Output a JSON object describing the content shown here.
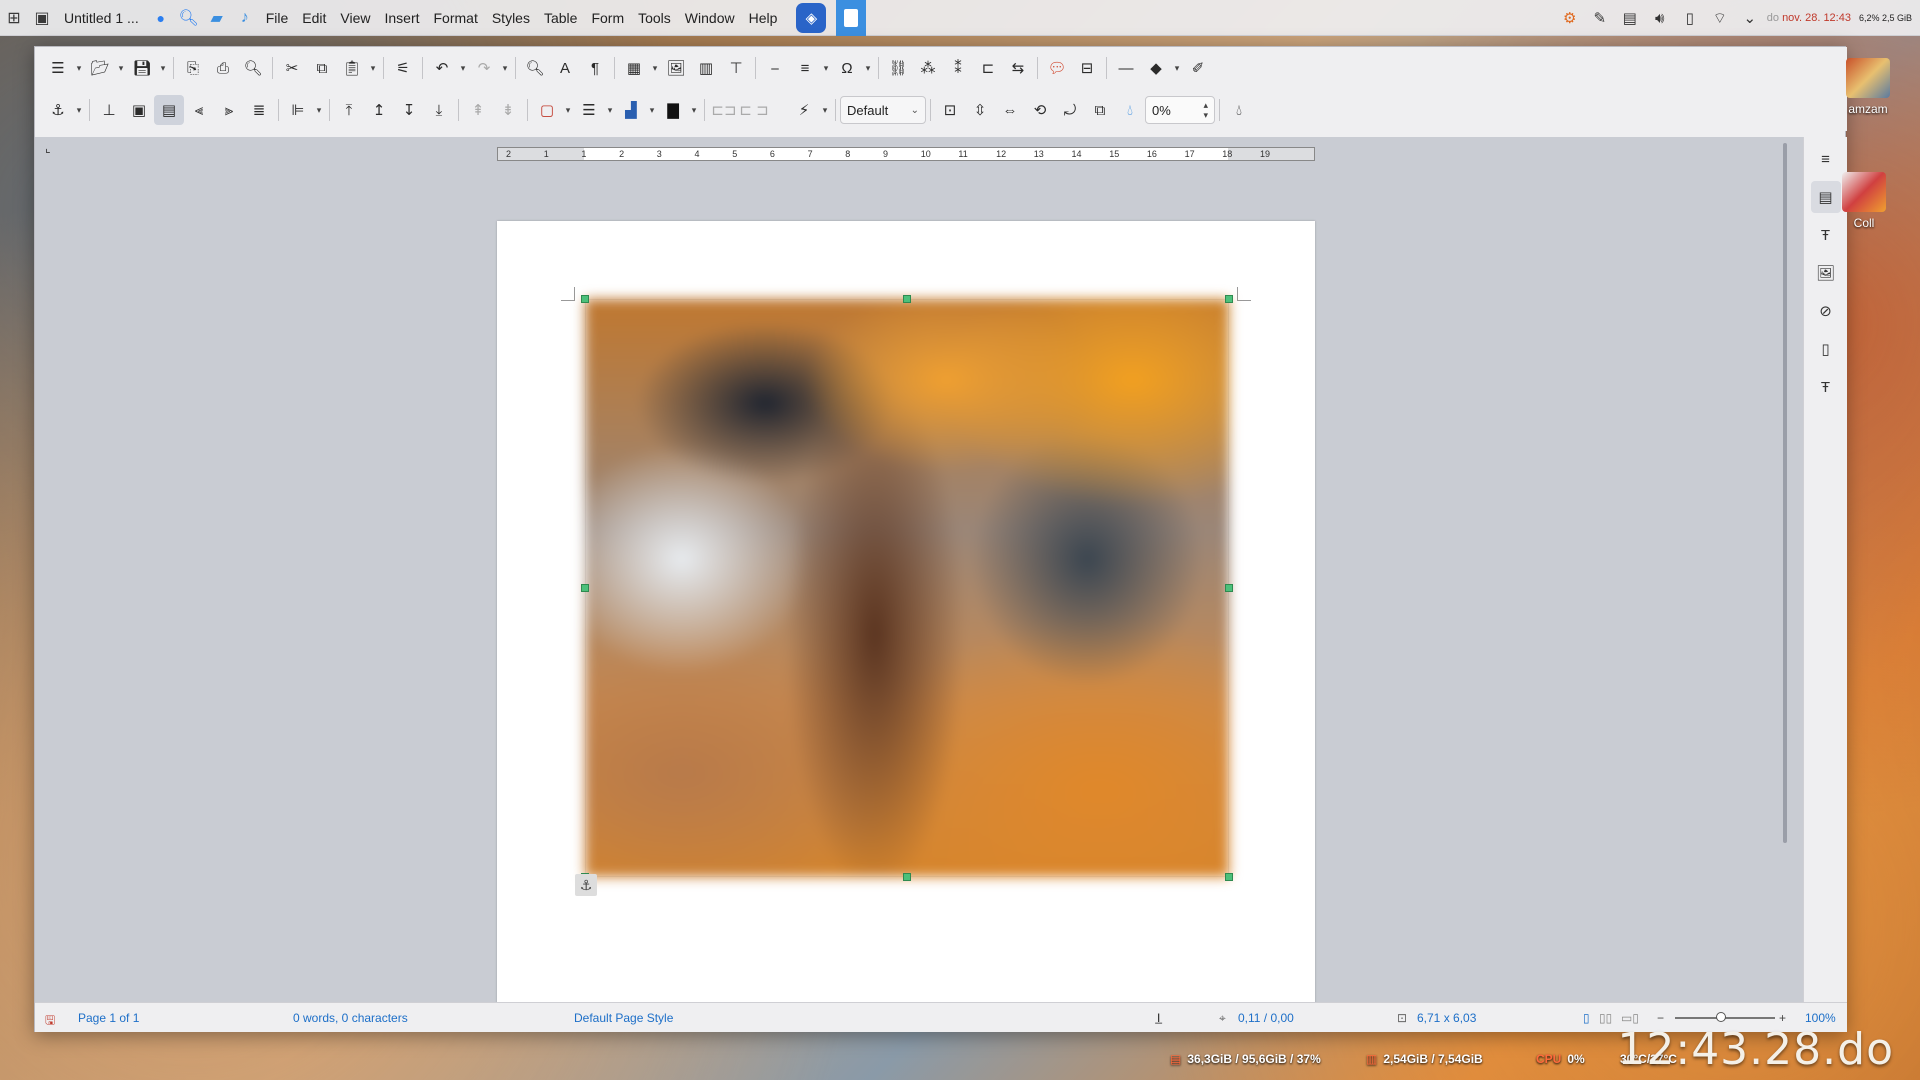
{
  "taskbar": {
    "window_title": "Untitled 1 ...",
    "menu": [
      "File",
      "Edit",
      "View",
      "Insert",
      "Format",
      "Styles",
      "Table",
      "Form",
      "Tools",
      "Window",
      "Help"
    ],
    "clock_text": "nov. 28. 12:43",
    "clock_prefix": "do",
    "mini_stats_top": "6,2%  2,5 GiB"
  },
  "toolbar2": {
    "frame_style": "Default",
    "transparency": "0%"
  },
  "ruler": {
    "numbers": [
      "2",
      "1",
      "1",
      "2",
      "3",
      "4",
      "5",
      "6",
      "7",
      "8",
      "9",
      "10",
      "11",
      "12",
      "13",
      "14",
      "15",
      "16",
      "17",
      "18",
      "19"
    ]
  },
  "statusbar": {
    "page": "Page 1 of 1",
    "words": "0 words, 0 characters",
    "page_style": "Default Page Style",
    "position": "0,11 / 0,00",
    "size": "6,71 x 6,03",
    "zoom": "100%",
    "zoom_minus": "−",
    "zoom_plus": "+"
  },
  "desktop": {
    "icon1_label": "amzam",
    "icon2_label": "Coll"
  },
  "system_monitor": {
    "disk": "36,3GiB / 95,6GiB / 37%",
    "ram": "2,54GiB / 7,54GiB",
    "cpu_label": "CPU",
    "cpu": "0%",
    "temp": "30°C/27°C",
    "big_clock": "12:43.28.do"
  },
  "colors": {
    "accent_blue": "#1d6fc8",
    "handle_green": "#4cc07a",
    "clock_red": "#c0392b"
  }
}
